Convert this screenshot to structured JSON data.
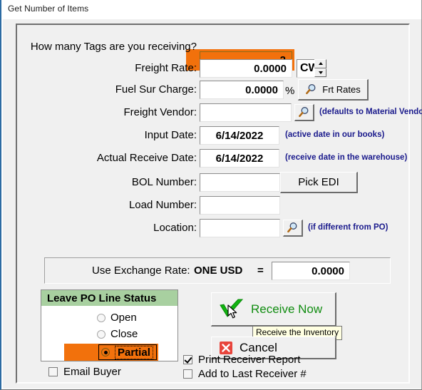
{
  "window": {
    "title": "Get Number of Items"
  },
  "form": {
    "tags": {
      "label": "How many Tags are you receiving?",
      "value": "2"
    },
    "freight_rate": {
      "label": "Freight Rate:",
      "value": "0.0000",
      "unit": "CWT"
    },
    "fuel_sur_charge": {
      "label": "Fuel Sur Charge:",
      "value": "0.0000",
      "percent_symbol": "%",
      "button": "Frt Rates"
    },
    "freight_vendor": {
      "label": "Freight Vendor:",
      "value": "",
      "note": "(defaults to Material Vendor)"
    },
    "input_date": {
      "label": "Input Date:",
      "value": "6/14/2022",
      "note": "(active date in our books)"
    },
    "actual_receive_date": {
      "label": "Actual Receive Date:",
      "value": "6/14/2022",
      "note": "(receive date in the warehouse)"
    },
    "bol_number": {
      "label": "BOL Number:",
      "value": "",
      "button": "Pick EDI"
    },
    "load_number": {
      "label": "Load Number:",
      "value": ""
    },
    "location": {
      "label": "Location:",
      "value": "",
      "note": "(if different from PO)"
    },
    "exchange_rate": {
      "label": "Use Exchange Rate:",
      "currency": "ONE USD",
      "equals": "=",
      "value": "0.0000"
    }
  },
  "po_line_status": {
    "header": "Leave PO Line Status",
    "options": [
      {
        "label": "Open",
        "selected": false
      },
      {
        "label": "Close",
        "selected": false
      },
      {
        "label": "Partial",
        "selected": true
      }
    ]
  },
  "actions": {
    "receive_now": "Receive Now",
    "receive_now_tooltip": "Receive the Inventory",
    "cancel": "Cancel"
  },
  "checkboxes": {
    "email_buyer": {
      "label": "Email Buyer",
      "checked": false
    },
    "print_receiver_report": {
      "label": "Print Receiver Report",
      "checked": true
    },
    "add_to_last_receiver": {
      "label": "Add to Last Receiver #",
      "checked": false
    }
  },
  "colors": {
    "highlight_orange": "#f2710c",
    "status_header_green": "#a8d0a0",
    "note_blue": "#1a1a8c",
    "receive_green": "#128d12",
    "cancel_red": "#e8453c"
  }
}
